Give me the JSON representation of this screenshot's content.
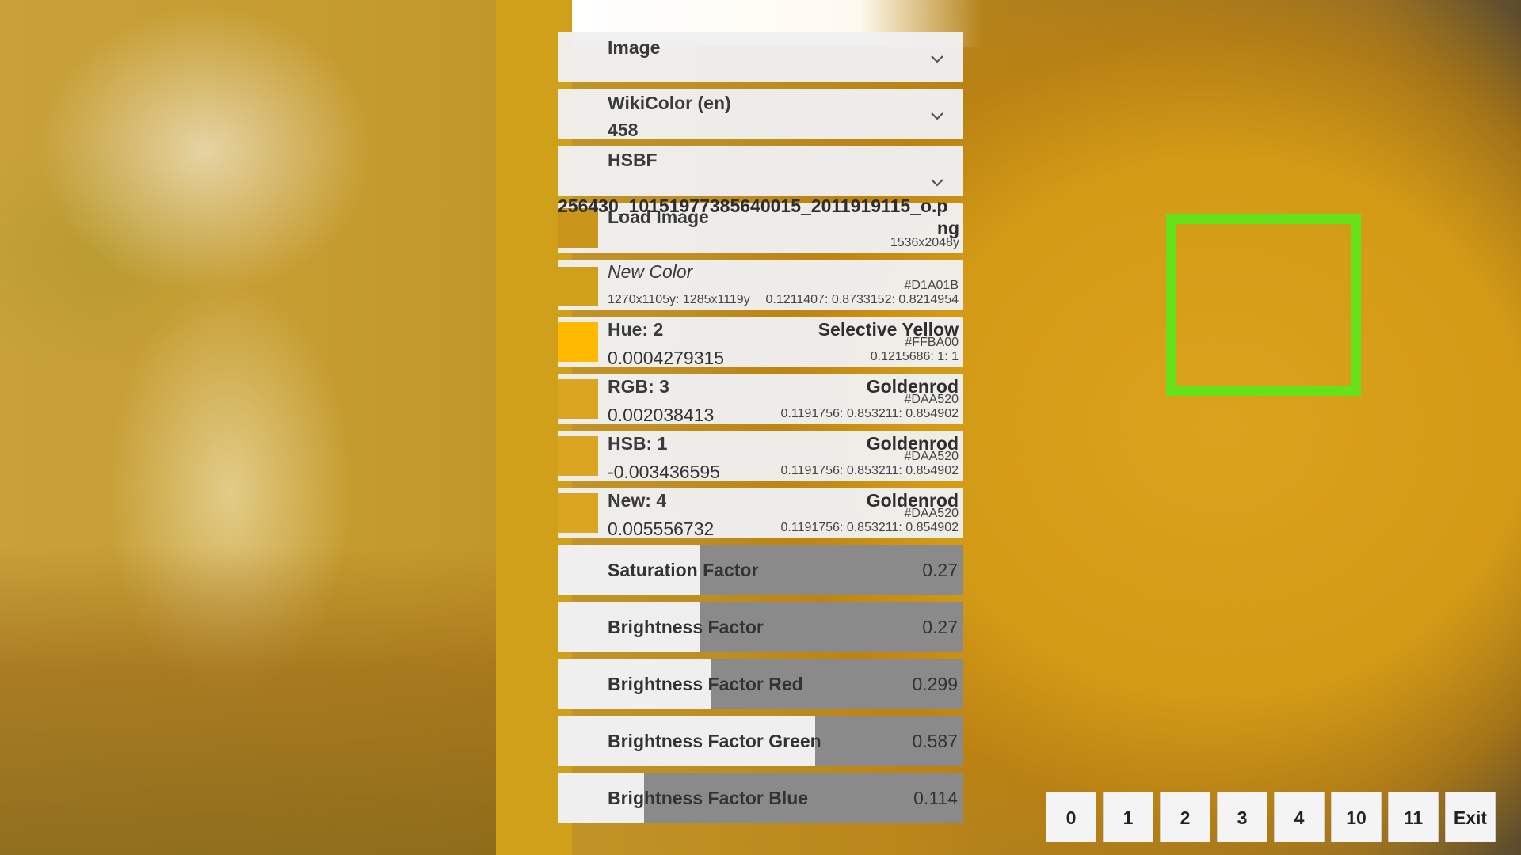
{
  "dropdowns": [
    {
      "label": "Image",
      "sub": ""
    },
    {
      "label": "WikiColor (en)",
      "sub": "458"
    },
    {
      "label": "HSBF",
      "sub": ""
    }
  ],
  "load_image": {
    "label": "Load Image",
    "filename_line1": "256430_10151977385640015_2011919115_o.p",
    "filename_line2": "ng",
    "dimensions": "1536x2048y",
    "swatch_color": "#c9951a"
  },
  "new_color": {
    "label": "New Color",
    "hex": "#D1A01B",
    "coords": "1270x1105y: 1285x1119y",
    "hsb": "0.1211407: 0.8733152: 0.8214954",
    "swatch_color": "#D1A01B"
  },
  "matches": [
    {
      "title": "Hue:",
      "index": "2",
      "delta": "0.0004279315",
      "name": "Selective Yellow",
      "hex": "#FFBA00",
      "hsb": "0.1215686: 1: 1",
      "swatch_color": "#FFBA00"
    },
    {
      "title": "RGB:",
      "index": "3",
      "delta": "0.002038413",
      "name": "Goldenrod",
      "hex": "#DAA520",
      "hsb": "0.1191756: 0.853211: 0.854902",
      "swatch_color": "#DAA520"
    },
    {
      "title": "HSB:",
      "index": "1",
      "delta": "-0.003436595",
      "name": "Goldenrod",
      "hex": "#DAA520",
      "hsb": "0.1191756: 0.853211: 0.854902",
      "swatch_color": "#DAA520"
    },
    {
      "title": "New:",
      "index": "4",
      "delta": "0.005556732",
      "name": "Goldenrod",
      "hex": "#DAA520",
      "hsb": "0.1191756: 0.853211: 0.854902",
      "swatch_color": "#DAA520"
    }
  ],
  "sliders": [
    {
      "label": "Saturation Factor",
      "value": "0.27",
      "fraction": 0.27
    },
    {
      "label": "Brightness Factor",
      "value": "0.27",
      "fraction": 0.27
    },
    {
      "label": "Brightness Factor Red",
      "value": "0.299",
      "fraction": 0.299
    },
    {
      "label": "Brightness Factor Green",
      "value": "0.587",
      "fraction": 0.587
    },
    {
      "label": "Brightness Factor Blue",
      "value": "0.114",
      "fraction": 0.114
    }
  ],
  "buttons": [
    "0",
    "1",
    "2",
    "3",
    "4",
    "10",
    "11",
    "Exit"
  ],
  "colors": {
    "panel_strip": "#D1A01B",
    "marker": "#66E21B"
  }
}
